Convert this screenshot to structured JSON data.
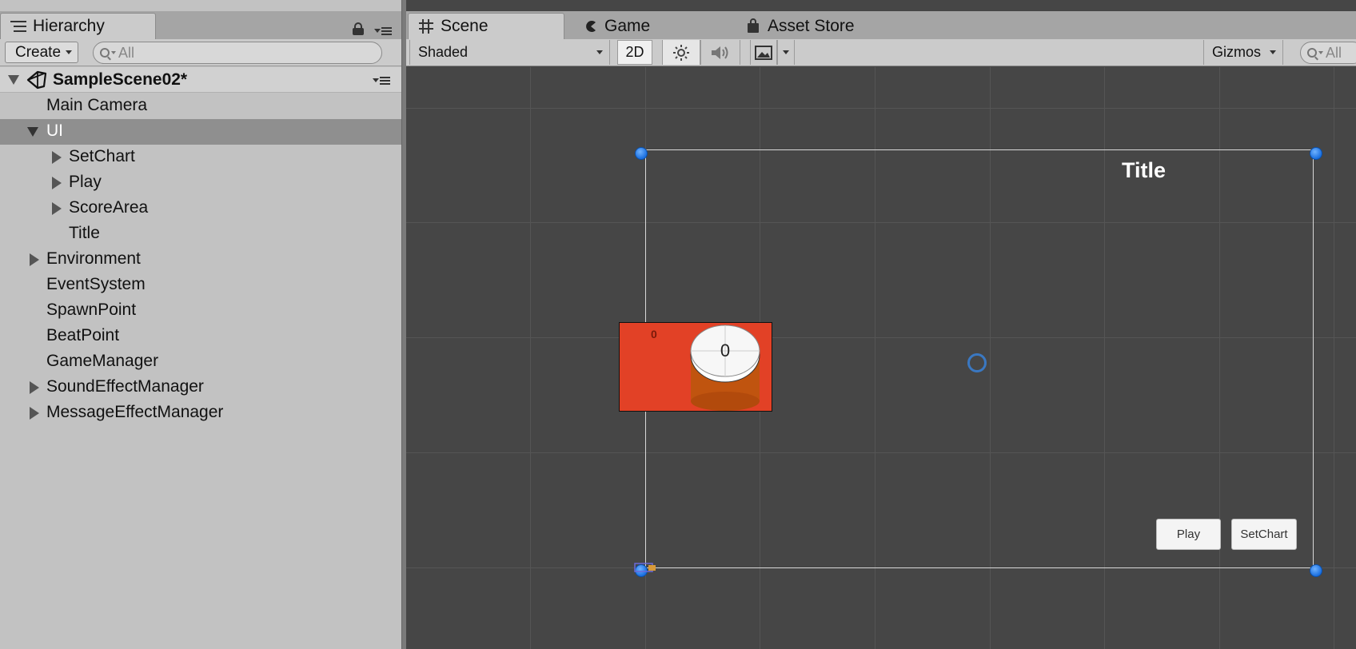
{
  "hierarchy": {
    "tab_label": "Hierarchy",
    "create_label": "Create",
    "search_placeholder": "All",
    "scene_name": "SampleScene02*",
    "items": [
      {
        "label": "Main Camera"
      },
      {
        "label": "UI"
      },
      {
        "label": "SetChart"
      },
      {
        "label": "Play"
      },
      {
        "label": "ScoreArea"
      },
      {
        "label": "Title"
      },
      {
        "label": "Environment"
      },
      {
        "label": "EventSystem"
      },
      {
        "label": "SpawnPoint"
      },
      {
        "label": "BeatPoint"
      },
      {
        "label": "GameManager"
      },
      {
        "label": "SoundEffectManager"
      },
      {
        "label": "MessageEffectManager"
      }
    ]
  },
  "scene_tabs": {
    "scene": "Scene",
    "game": "Game",
    "asset_store": "Asset Store"
  },
  "scene_toolbar": {
    "shading_mode": "Shaded",
    "mode_2d": "2D",
    "gizmos": "Gizmos",
    "search_placeholder": "All"
  },
  "viewport": {
    "title_text": "Title",
    "score_small": "0",
    "score_big": "0",
    "play_button": "Play",
    "setchart_button": "SetChart"
  },
  "colors": {
    "selection": "#8f8f8f",
    "score_area": "#e24126",
    "handle": "#1a6fe0",
    "viewport_bg": "#464646"
  }
}
